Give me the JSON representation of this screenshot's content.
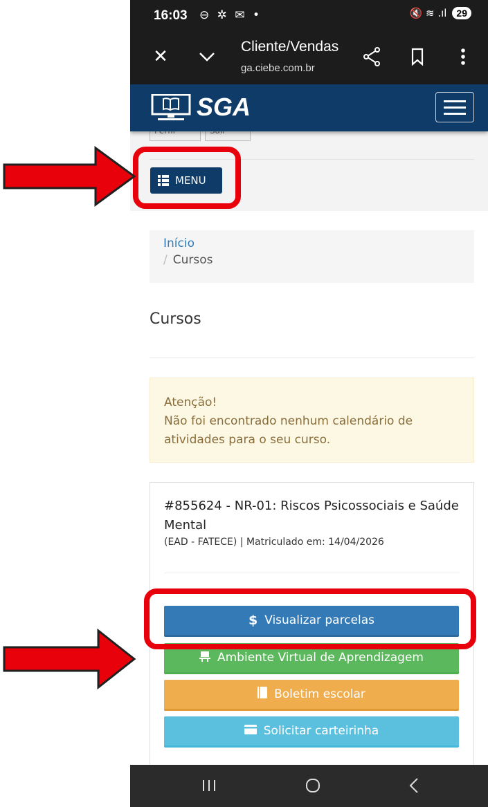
{
  "status_bar": {
    "time": "16:03",
    "status_icons": "⊖ ✲ ✉ •",
    "signal_icons": "🔇 ≋ .ıl",
    "battery": "29"
  },
  "browser": {
    "title": "Cliente/Vendas",
    "url": "ga.ciebe.com.br",
    "icons": [
      "close-icon",
      "chevron-down-icon",
      "share-icon",
      "bookmark-icon",
      "more-vertical-icon"
    ]
  },
  "app": {
    "logo": "SGA",
    "brand_color": "#0f3b68"
  },
  "toolbar": {
    "profile_label": "Perfil",
    "exit_label": "Sair",
    "menu_label": "MENU"
  },
  "breadcrumb": {
    "home": "Início",
    "separator": "/",
    "current": "Cursos"
  },
  "page": {
    "title": "Cursos"
  },
  "alert": {
    "title": "Atenção!",
    "message": "Não foi encontrado nenhum calendário de atividades para o seu curso."
  },
  "course": {
    "title": "#855624 - NR-01: Riscos Psicossociais e Saúde Mental",
    "meta": "(EAD - FATECE) | Matriculado em: 14/04/2026",
    "actions": [
      {
        "label": "Visualizar parcelas",
        "icon": "dollar-icon",
        "color": "#337ab7"
      },
      {
        "label": "Ambiente Virtual de Aprendizagem",
        "icon": "classroom-icon",
        "color": "#5cb85c"
      },
      {
        "label": "Boletim escolar",
        "icon": "book-icon",
        "color": "#f0ad4e"
      },
      {
        "label": "Solicitar carteirinha",
        "icon": "card-icon",
        "color": "#5bc0de"
      }
    ]
  },
  "navbar": {
    "icons": [
      "recent-apps-icon",
      "home-icon",
      "back-icon"
    ]
  },
  "annotation_color": "#e8000b"
}
